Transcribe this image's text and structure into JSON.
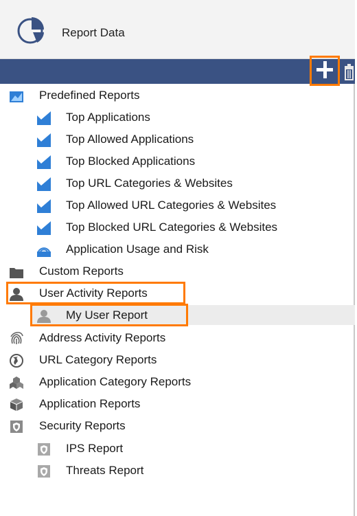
{
  "panel": {
    "title": "Report Data",
    "icon": "pie-chart-icon"
  },
  "toolbar": {
    "add_icon": "plus-icon",
    "delete_icon": "trash-icon"
  },
  "tree": {
    "predefined": {
      "label": "Predefined Reports",
      "icon": "report-folder-icon",
      "items": [
        "Top Applications",
        "Top Allowed Applications",
        "Top Blocked Applications",
        "Top URL Categories & Websites",
        "Top Allowed URL Categories & Websites",
        "Top Blocked URL Categories & Websites",
        "Application Usage and Risk"
      ]
    },
    "custom": {
      "label": "Custom Reports",
      "icon": "folder-icon"
    },
    "user_activity": {
      "label": "User Activity Reports",
      "icon": "user-icon",
      "items": [
        "My User Report"
      ]
    },
    "address_activity": {
      "label": "Address Activity Reports",
      "icon": "fingerprint-icon"
    },
    "url_category": {
      "label": "URL Category Reports",
      "icon": "globe-icon"
    },
    "app_category": {
      "label": "Application Category Reports",
      "icon": "cubes-icon"
    },
    "applications": {
      "label": "Application Reports",
      "icon": "cube-icon"
    },
    "security": {
      "label": "Security Reports",
      "icon": "shield-icon",
      "items": [
        "IPS Report",
        "Threats Report"
      ]
    }
  },
  "colors": {
    "toolbar": "#3a5283",
    "highlight": "#ff7a00",
    "report_blue": "#2f7fd6"
  }
}
